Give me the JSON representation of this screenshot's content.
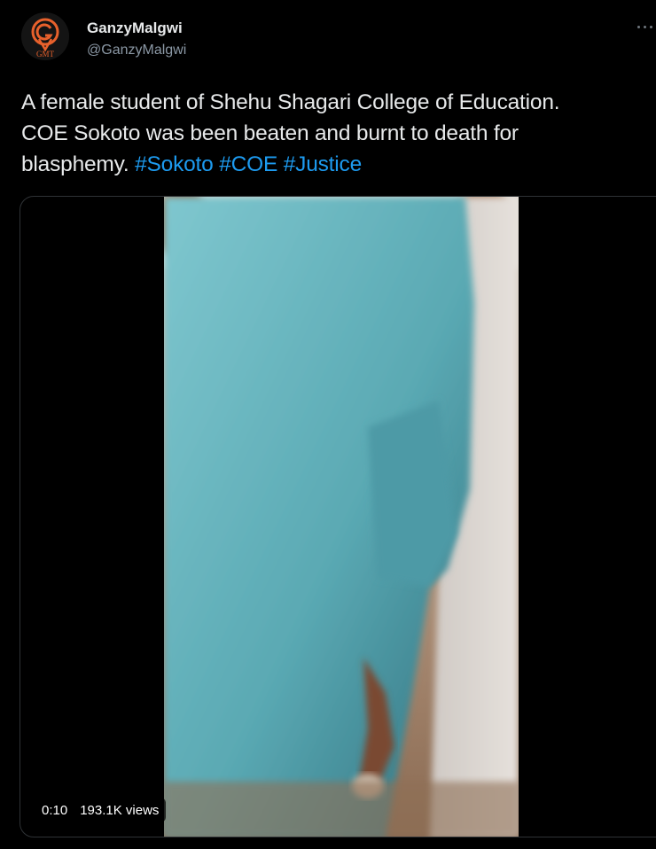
{
  "author": {
    "display_name": "GanzyMalgwi",
    "handle": "@GanzyMalgwi",
    "avatar_text": "GMT"
  },
  "tweet": {
    "text_line_1": "A female student of Shehu Shagari College of Education.",
    "text_line_2": "COE Sokoto was been beaten and burnt to death for",
    "text_line_3_plain": "blasphemy. ",
    "hashtags": [
      "#Sokoto",
      "#COE",
      "#Justice"
    ]
  },
  "media": {
    "type": "video",
    "duration": "0:10",
    "views": "193.1K views"
  },
  "icons": {
    "more": "more-options-icon"
  },
  "colors": {
    "background": "#000000",
    "text": "#e7e9ea",
    "secondary_text": "#8b98a5",
    "link": "#1d9bf0",
    "border": "#2f3336",
    "avatar_accent": "#e8612c"
  }
}
